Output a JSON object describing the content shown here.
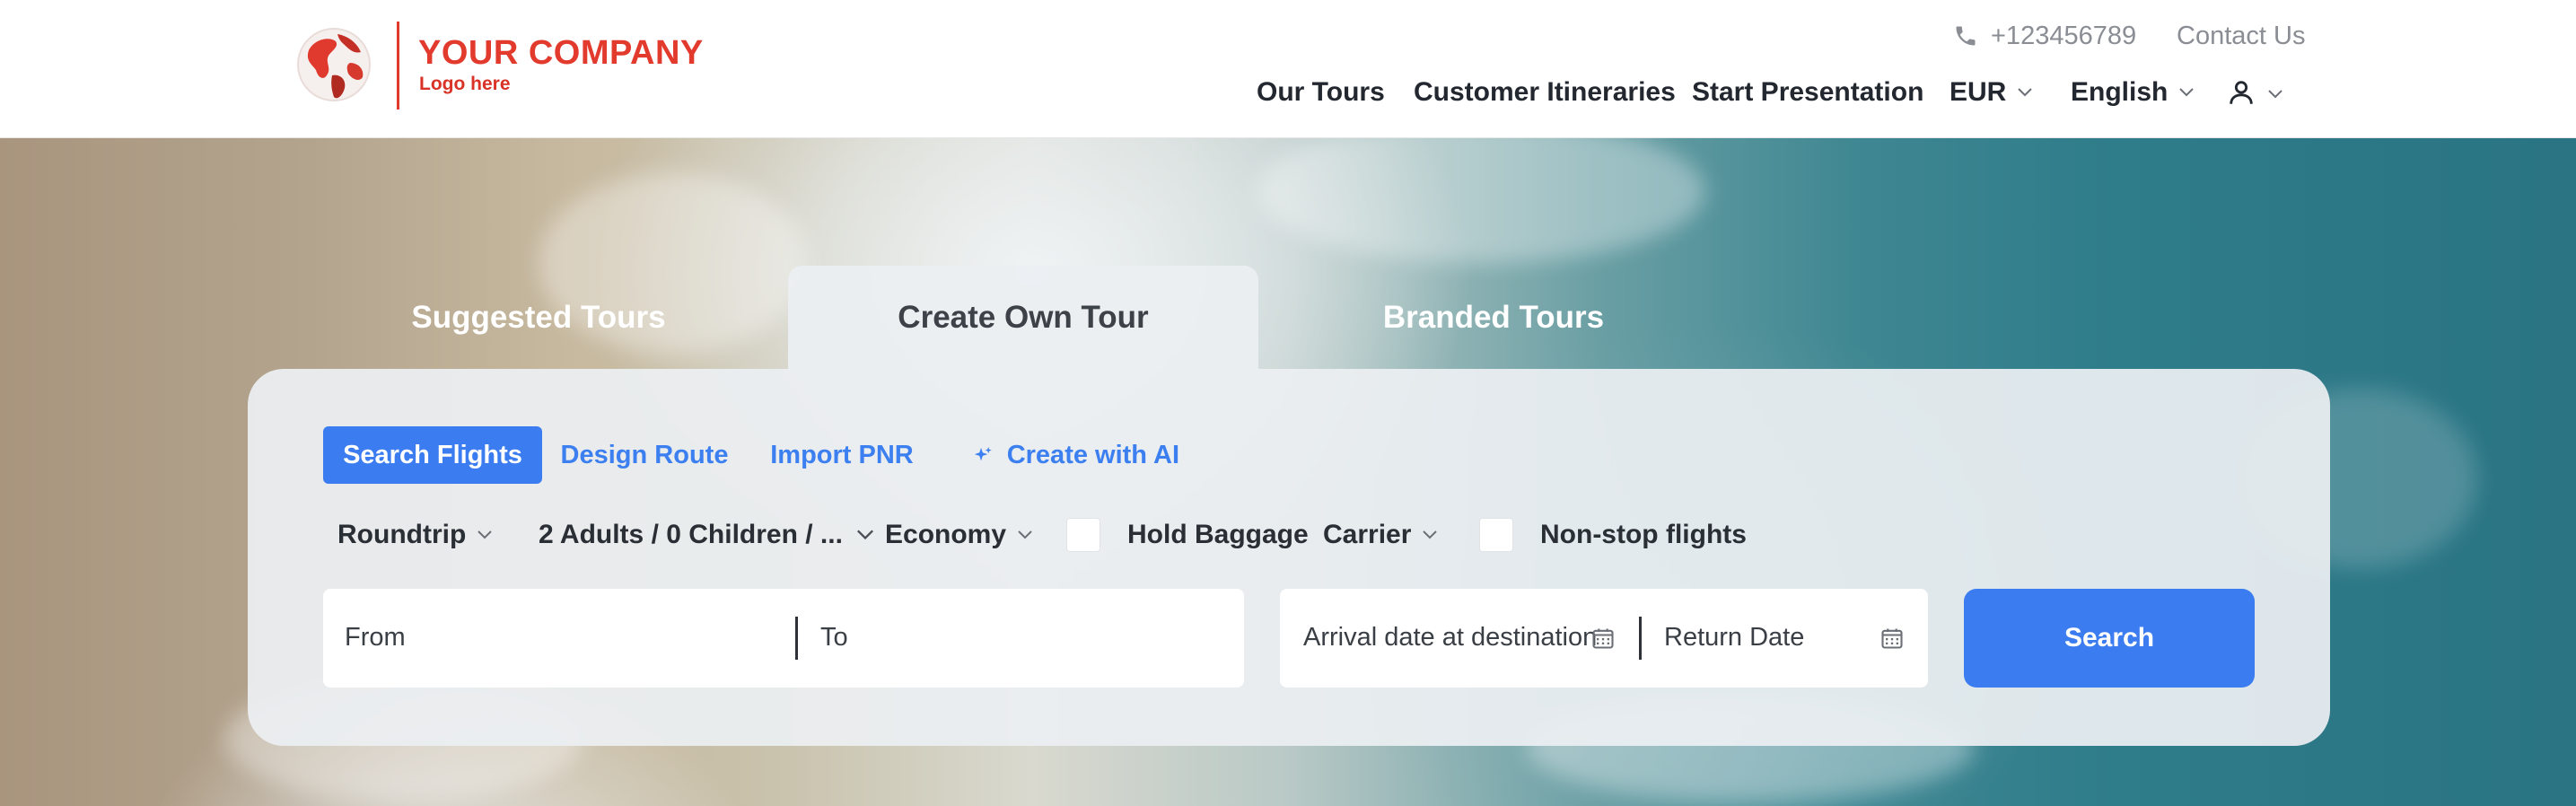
{
  "header": {
    "company_name": "YOUR COMPANY",
    "company_sub": "Logo here",
    "phone": "+123456789",
    "contact": "Contact Us",
    "nav": {
      "our_tours": "Our Tours",
      "itineraries": "Customer Itineraries",
      "presentation": "Start Presentation",
      "currency": "EUR",
      "language": "English"
    },
    "icons": [
      "globe-logo",
      "phone-icon",
      "chevron-down-icon",
      "user-icon"
    ]
  },
  "tabs": {
    "suggested": "Suggested Tours",
    "create_own": "Create Own Tour",
    "branded": "Branded Tours",
    "active": "Create Own Tour"
  },
  "subtabs": {
    "search_flights": "Search Flights",
    "design_route": "Design Route",
    "import_pnr": "Import PNR",
    "create_ai": "Create with AI",
    "active": "Search Flights"
  },
  "options": {
    "trip_type": "Roundtrip",
    "passengers": "2 Adults / 0 Children / ...",
    "cabin": "Economy",
    "hold_baggage": "Hold Baggage",
    "hold_baggage_checked": false,
    "carrier": "Carrier",
    "nonstop": "Non-stop flights",
    "nonstop_checked": false
  },
  "fields": {
    "from": "From",
    "to": "To",
    "arrival_date": "Arrival date at destination",
    "return_date": "Return Date"
  },
  "search_button": "Search",
  "colors": {
    "brand_red": "#e23b2e",
    "accent_blue": "#3b7cf0",
    "panel_bg": "#eceff2"
  }
}
